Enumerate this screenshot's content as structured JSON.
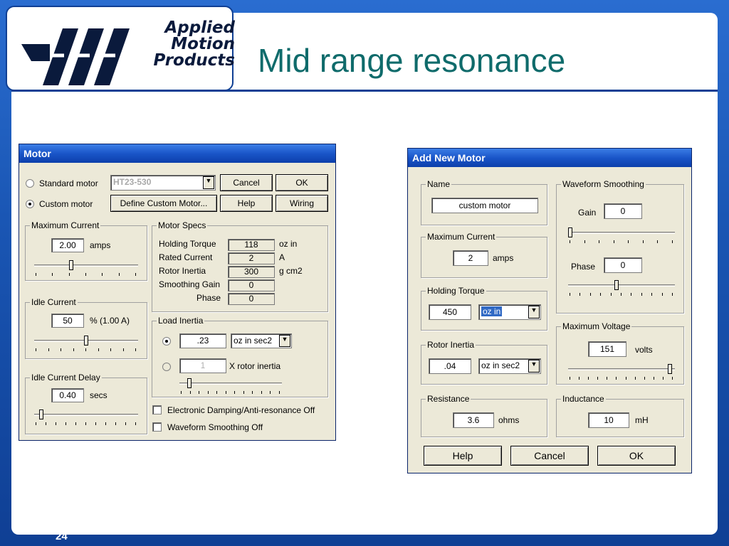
{
  "slide": {
    "title": "Mid range resonance",
    "page_number": "24",
    "logo": {
      "line1": "Applied",
      "line2": "Motion",
      "line3": "Products"
    }
  },
  "colors": {
    "background": "#1a56b4",
    "title": "#0f6b6b",
    "titlebar": "#1a55c8",
    "dialog": "#ece9d8"
  },
  "motor_dialog": {
    "title": "Motor",
    "standard_motor": "Standard motor",
    "custom_motor": "Custom motor",
    "motor_select": "HT23-530",
    "define_custom_motor": "Define Custom Motor...",
    "cancel": "Cancel",
    "ok": "OK",
    "help": "Help",
    "wiring": "Wiring",
    "max_current": {
      "label": "Maximum Current",
      "value": "2.00",
      "unit": "amps",
      "slider_fraction": 0.35
    },
    "idle_current": {
      "label": "Idle Current",
      "value": "50",
      "unit": "% (1.00 A)",
      "slider_fraction": 0.5
    },
    "idle_delay": {
      "label": "Idle Current Delay",
      "value": "0.40",
      "unit": "secs",
      "slider_fraction": 0.05
    },
    "motor_specs": {
      "label": "Motor Specs",
      "holding_torque": {
        "label": "Holding Torque",
        "value": "118",
        "unit": "oz in"
      },
      "rated_current": {
        "label": "Rated Current",
        "value": "2",
        "unit": "A"
      },
      "rotor_inertia": {
        "label": "Rotor Inertia",
        "value": "300",
        "unit": "g cm2"
      },
      "smoothing_gain": {
        "label": "Smoothing Gain",
        "value": "0"
      },
      "phase": {
        "label": "Phase",
        "value": "0"
      }
    },
    "load_inertia": {
      "label": "Load Inertia",
      "value": ".23",
      "unit": "oz in sec2",
      "ratio_value": "1",
      "ratio_label": "X rotor inertia",
      "slider_fraction": 0.08
    },
    "electronic_damping": "Electronic Damping/Anti-resonance Off",
    "waveform_smoothing_off": "Waveform Smoothing Off"
  },
  "add_motor_dialog": {
    "title": "Add New Motor",
    "name": {
      "label": "Name",
      "value": "custom motor"
    },
    "max_current": {
      "label": "Maximum Current",
      "value": "2",
      "unit": "amps"
    },
    "holding_torque": {
      "label": "Holding Torque",
      "value": "450",
      "unit": "oz in"
    },
    "rotor_inertia": {
      "label": "Rotor Inertia",
      "value": ".04",
      "unit": "oz in sec2"
    },
    "resistance": {
      "label": "Resistance",
      "value": "3.6",
      "unit": "ohms"
    },
    "waveform_smoothing": {
      "label": "Waveform Smoothing",
      "gain_label": "Gain",
      "gain_value": "0",
      "gain_slider_fraction": 0.0,
      "phase_label": "Phase",
      "phase_value": "0",
      "phase_slider_fraction": 0.45
    },
    "max_voltage": {
      "label": "Maximum Voltage",
      "value": "151",
      "unit": "volts",
      "slider_fraction": 0.97
    },
    "inductance": {
      "label": "Inductance",
      "value": "10",
      "unit": "mH"
    },
    "help": "Help",
    "cancel": "Cancel",
    "ok": "OK"
  }
}
